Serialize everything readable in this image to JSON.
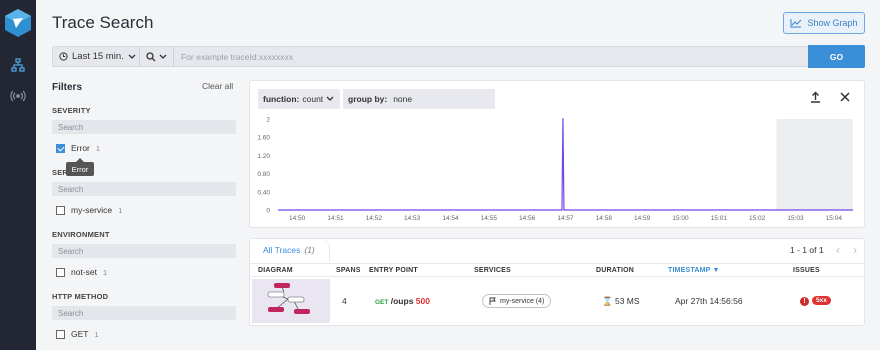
{
  "header": {
    "title": "Trace Search",
    "show_graph_label": "Show Graph"
  },
  "search": {
    "time_range": "Last 15 min.",
    "placeholder": "For example traceId:xxxxxxxx",
    "value": "",
    "go_label": "GO"
  },
  "filters": {
    "title": "Filters",
    "clear_all": "Clear all",
    "search_placeholder": "Search",
    "tooltip": "Error",
    "sections": [
      {
        "title": "SEVERITY",
        "options": [
          {
            "label": "Error",
            "count": "1",
            "checked": true
          }
        ]
      },
      {
        "title": "SERVICE",
        "options": [
          {
            "label": "my-service",
            "count": "1",
            "checked": false
          }
        ]
      },
      {
        "title": "ENVIRONMENT",
        "options": [
          {
            "label": "not-set",
            "count": "1",
            "checked": false
          }
        ]
      },
      {
        "title": "HTTP METHOD",
        "options": [
          {
            "label": "GET",
            "count": "1",
            "checked": false
          }
        ]
      }
    ]
  },
  "graph": {
    "function_label": "function:",
    "function_value": "count",
    "groupby_label": "group by:",
    "groupby_value": "none"
  },
  "chart_data": {
    "type": "line",
    "categories": [
      "14:50",
      "14:51",
      "14:52",
      "14:53",
      "14:54",
      "14:55",
      "14:56",
      "14:57",
      "14:58",
      "14:59",
      "15:00",
      "15:01",
      "15:02",
      "15:03",
      "15:04"
    ],
    "yticks": [
      "0",
      "0.40",
      "0.80",
      "1.20",
      "1.60",
      "2"
    ],
    "ylim": [
      0,
      2
    ],
    "series": [
      {
        "x": [
          "14:56:56"
        ],
        "y": [
          2
        ]
      }
    ],
    "line_color": "#7048e8",
    "shaded_region_start": "15:02:30"
  },
  "traces": {
    "tab_label": "All Traces",
    "tab_count": "(1)",
    "pager": "1 - 1 of 1",
    "columns": [
      "DIAGRAM",
      "SPANS",
      "ENTRY POINT",
      "SERVICES",
      "DURATION",
      "TIMESTAMP",
      "ISSUES"
    ],
    "rows": [
      {
        "spans": "4",
        "method": "GET",
        "path": "/oups",
        "status": "500",
        "service": "my-service (4)",
        "duration": "53 MS",
        "timestamp": "Apr 27th 14:56:56",
        "issue_badge": "5xx",
        "issue_icon": "!"
      }
    ]
  }
}
